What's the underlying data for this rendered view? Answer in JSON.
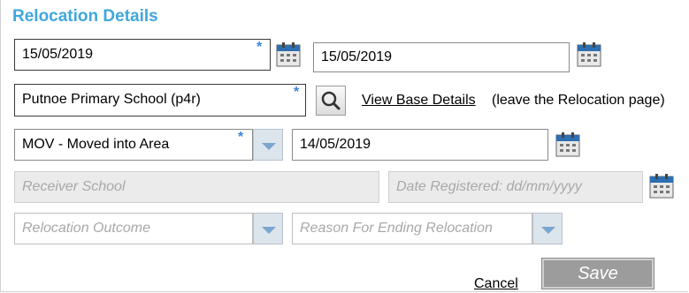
{
  "header": {
    "title": "Relocation Details"
  },
  "row1": {
    "start_date": "15/05/2019",
    "end_date": "15/05/2019"
  },
  "row2": {
    "school": "Putnoe Primary School (p4r)",
    "view_link": "View Base Details",
    "view_note": "(leave the Relocation page)"
  },
  "row3": {
    "reason_select": "MOV - Moved into Area",
    "reason_date": "14/05/2019"
  },
  "row4": {
    "receiver_placeholder": "Receiver School",
    "date_registered_placeholder": "Date Registered: dd/mm/yyyy"
  },
  "row5": {
    "outcome_placeholder": "Relocation Outcome",
    "ending_reason_placeholder": "Reason For Ending Relocation"
  },
  "actions": {
    "cancel": "Cancel",
    "save": "Save"
  },
  "required_marker": "*",
  "icons": {
    "calendar": "calendar-icon",
    "search": "magnifier-icon",
    "dropdown": "chevron-down-icon"
  },
  "colors": {
    "title": "#3fa7dd",
    "required": "#3a87d8",
    "save_bg": "#9c9c9c"
  }
}
